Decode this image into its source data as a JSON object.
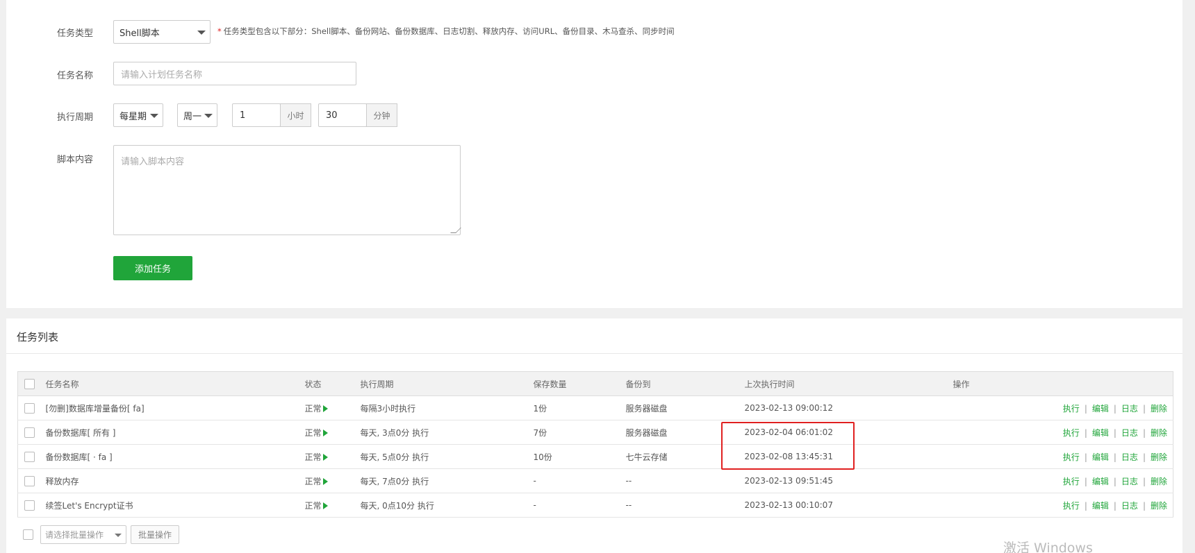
{
  "form": {
    "task_type": {
      "label": "任务类型",
      "value": "Shell脚本",
      "hint_star": "*",
      "hint": "任务类型包含以下部分：Shell脚本、备份网站、备份数据库、日志切割、释放内存、访问URL、备份目录、木马查杀、同步时间"
    },
    "task_name": {
      "label": "任务名称",
      "placeholder": "请输入计划任务名称"
    },
    "cycle": {
      "label": "执行周期",
      "period": "每星期",
      "weekday": "周一",
      "hour": "1",
      "hour_unit": "小时",
      "minute": "30",
      "minute_unit": "分钟"
    },
    "script": {
      "label": "脚本内容",
      "placeholder": "请输入脚本内容"
    },
    "submit_label": "添加任务"
  },
  "list": {
    "title": "任务列表",
    "headers": {
      "name": "任务名称",
      "status": "状态",
      "cycle": "执行周期",
      "keep": "保存数量",
      "backup_to": "备份到",
      "last_run": "上次执行时间",
      "ops": "操作"
    },
    "rows": [
      {
        "name": "[勿删]数据库增量备份[      fa]",
        "status": "正常",
        "cycle": "每隔3小时执行",
        "keep": "1份",
        "backup_to": "服务器磁盘",
        "last_run": "2023-02-13 09:00:12"
      },
      {
        "name": "备份数据库[ 所有 ]",
        "status": "正常",
        "cycle": "每天, 3点0分 执行",
        "keep": "7份",
        "backup_to": "服务器磁盘",
        "last_run": "2023-02-04 06:01:02"
      },
      {
        "name": "备份数据库[ ·      fa ]",
        "status": "正常",
        "cycle": "每天, 5点0分 执行",
        "keep": "10份",
        "backup_to": "七牛云存储",
        "last_run": "2023-02-08 13:45:31"
      },
      {
        "name": "释放内存",
        "status": "正常",
        "cycle": "每天, 7点0分 执行",
        "keep": "-",
        "backup_to": "--",
        "last_run": "2023-02-13 09:51:45"
      },
      {
        "name": "续签Let's Encrypt证书",
        "status": "正常",
        "cycle": "每天, 0点10分 执行",
        "keep": "-",
        "backup_to": "--",
        "last_run": "2023-02-13 00:10:07"
      }
    ],
    "ops": {
      "run": "执行",
      "edit": "编辑",
      "log": "日志",
      "delete": "删除",
      "sep": "|"
    },
    "batch": {
      "placeholder": "请选择批量操作",
      "button": "批量操作"
    }
  },
  "watermark": "激活 Windows",
  "colors": {
    "accent": "#20a53a",
    "highlight_box": "#e02020"
  }
}
